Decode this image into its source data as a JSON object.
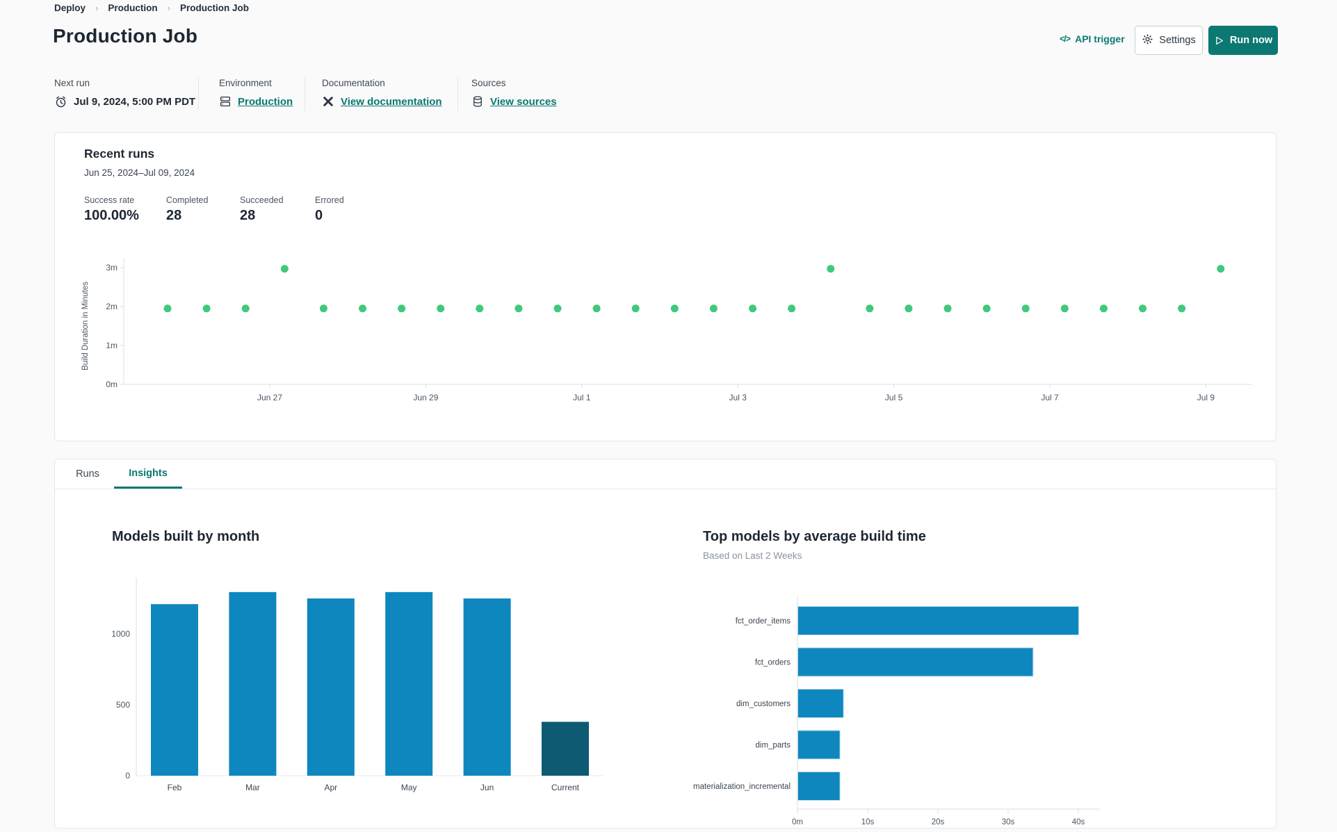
{
  "colors": {
    "accent_teal": "#0b7872",
    "text_dark": "#1d2733",
    "text_gray": "#4b5563",
    "text_light_gray": "#8b949e",
    "card_border": "#e4e7ea",
    "axis_gray": "#d8dcdf",
    "bar_blue": "#0e87be",
    "bar_dark_teal": "#0e5a73",
    "dot_green": "#3fc97c"
  },
  "icons": {
    "api_trigger_glyph": "</>"
  },
  "breadcrumb": {
    "items": [
      "Deploy",
      "Production",
      "Production Job"
    ]
  },
  "header": {
    "title": "Production Job",
    "api_trigger": "API trigger",
    "settings": "Settings",
    "run_now": "Run now"
  },
  "info": {
    "next_run_label": "Next run",
    "next_run_value": "Jul 9, 2024, 5:00 PM PDT",
    "environment_label": "Environment",
    "environment_value": "Production",
    "documentation_label": "Documentation",
    "documentation_value": "View documentation",
    "sources_label": "Sources",
    "sources_value": "View sources"
  },
  "recent_runs": {
    "title": "Recent runs",
    "date_range": "Jun 25, 2024–Jul 09, 2024",
    "stats": [
      {
        "label": "Success rate",
        "value": "100.00%"
      },
      {
        "label": "Completed",
        "value": "28"
      },
      {
        "label": "Succeeded",
        "value": "28"
      },
      {
        "label": "Errored",
        "value": "0"
      }
    ]
  },
  "tabs": {
    "runs": "Runs",
    "insights": "Insights"
  },
  "charts": {
    "models_by_month_title": "Models built by month",
    "top_models_title": "Top models by average build time",
    "top_models_subtitle": "Based on Last 2 Weeks"
  },
  "chart_data": [
    {
      "type": "scatter",
      "name": "recent-runs-build-duration",
      "ylabel": "Build Duration in Minutes",
      "ylim": [
        0,
        3.2
      ],
      "yticks": [
        {
          "value": 0,
          "label": "0m"
        },
        {
          "value": 1,
          "label": "1m"
        },
        {
          "value": 2,
          "label": "2m"
        },
        {
          "value": 3,
          "label": "3m"
        }
      ],
      "x_day0": "Jun 25, 2024",
      "xticks": [
        {
          "day": 2,
          "label": "Jun 27"
        },
        {
          "day": 4,
          "label": "Jun 29"
        },
        {
          "day": 6,
          "label": "Jul 1"
        },
        {
          "day": 8,
          "label": "Jul 3"
        },
        {
          "day": 10,
          "label": "Jul 5"
        },
        {
          "day": 12,
          "label": "Jul 7"
        },
        {
          "day": 14,
          "label": "Jul 9"
        }
      ],
      "point_color": "#3fc97c",
      "grid": false,
      "points": [
        {
          "day": 0.69,
          "minutes": 1.95
        },
        {
          "day": 1.19,
          "minutes": 1.95
        },
        {
          "day": 1.69,
          "minutes": 1.95
        },
        {
          "day": 2.19,
          "minutes": 2.97
        },
        {
          "day": 2.69,
          "minutes": 1.95
        },
        {
          "day": 3.19,
          "minutes": 1.95
        },
        {
          "day": 3.69,
          "minutes": 1.95
        },
        {
          "day": 4.19,
          "minutes": 1.95
        },
        {
          "day": 4.69,
          "minutes": 1.95
        },
        {
          "day": 5.19,
          "minutes": 1.95
        },
        {
          "day": 5.69,
          "minutes": 1.95
        },
        {
          "day": 6.19,
          "minutes": 1.95
        },
        {
          "day": 6.69,
          "minutes": 1.95
        },
        {
          "day": 7.19,
          "minutes": 1.95
        },
        {
          "day": 7.69,
          "minutes": 1.95
        },
        {
          "day": 8.19,
          "minutes": 1.95
        },
        {
          "day": 8.69,
          "minutes": 1.95
        },
        {
          "day": 9.19,
          "minutes": 2.97
        },
        {
          "day": 9.69,
          "minutes": 1.95
        },
        {
          "day": 10.19,
          "minutes": 1.95
        },
        {
          "day": 10.69,
          "minutes": 1.95
        },
        {
          "day": 11.19,
          "minutes": 1.95
        },
        {
          "day": 11.69,
          "minutes": 1.95
        },
        {
          "day": 12.19,
          "minutes": 1.95
        },
        {
          "day": 12.69,
          "minutes": 1.95
        },
        {
          "day": 13.19,
          "minutes": 1.95
        },
        {
          "day": 13.69,
          "minutes": 1.95
        },
        {
          "day": 14.19,
          "minutes": 2.97
        }
      ]
    },
    {
      "type": "bar",
      "name": "models-built-by-month",
      "title": "Models built by month",
      "categories": [
        "Feb",
        "Mar",
        "Apr",
        "May",
        "Jun",
        "Current"
      ],
      "values": [
        1210,
        1295,
        1250,
        1295,
        1250,
        380
      ],
      "yticks": [
        0,
        500,
        1000
      ],
      "ylim": [
        0,
        1400
      ],
      "bar_color": "#0e87be",
      "highlight_last_color": "#0e5a73",
      "grid": false
    },
    {
      "type": "bar",
      "orientation": "horizontal",
      "name": "top-models-by-avg-build-time",
      "title": "Top models by average build time",
      "subtitle": "Based on Last 2 Weeks",
      "categories": [
        "fct_order_items",
        "fct_orders",
        "dim_customers",
        "dim_parts",
        "materialization_incremental"
      ],
      "values_seconds": [
        40,
        33.5,
        6.5,
        6,
        6
      ],
      "xlim_seconds": [
        0,
        43
      ],
      "xticks": [
        {
          "seconds": 0,
          "label": "0m"
        },
        {
          "seconds": 10,
          "label": "10s"
        },
        {
          "seconds": 20,
          "label": "20s"
        },
        {
          "seconds": 30,
          "label": "30s"
        },
        {
          "seconds": 40,
          "label": "40s"
        }
      ],
      "bar_color": "#0e87be",
      "grid": false
    }
  ]
}
